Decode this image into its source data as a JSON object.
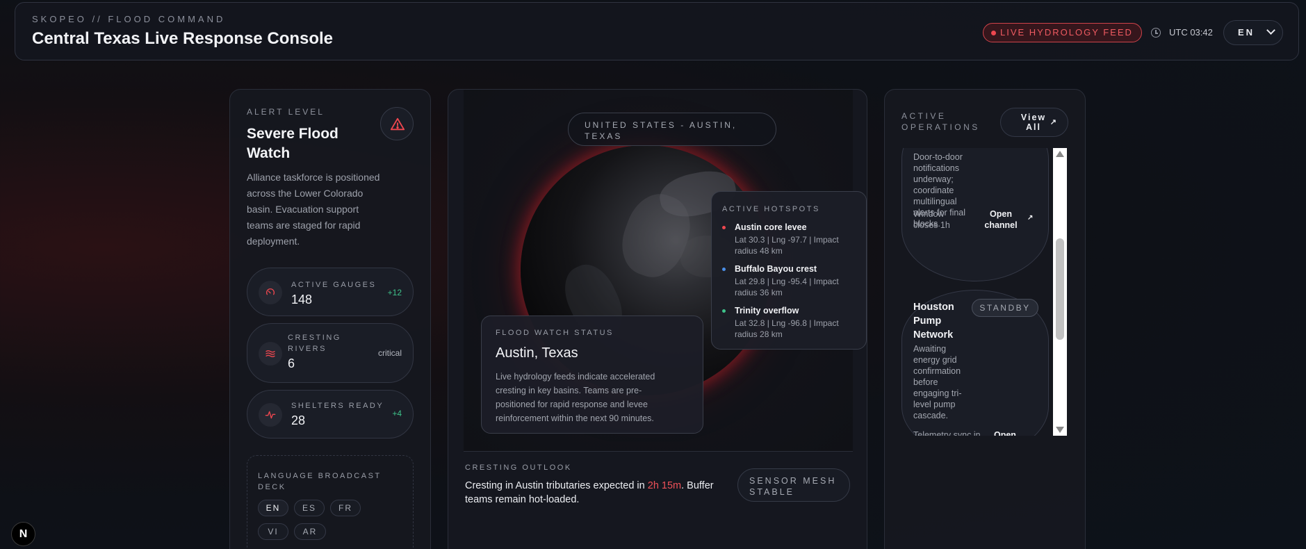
{
  "header": {
    "kicker": "SKOPEO // FLOOD COMMAND",
    "title": "Central Texas Live Response Console",
    "live_feed": "LIVE HYDROLOGY FEED",
    "utc": "UTC 03:42",
    "language": "EN",
    "colors": {
      "accent_red": "#ef474f"
    }
  },
  "alert": {
    "kicker": "ALERT LEVEL",
    "title": "Severe Flood Watch",
    "icon": "warning-triangle-icon",
    "description": "Alliance taskforce is positioned across the Lower Colorado basin. Evacuation support teams are staged for rapid deployment."
  },
  "stats": [
    {
      "label": "ACTIVE GAUGES",
      "value": "148",
      "delta": "+12",
      "icon": "gauge-icon",
      "delta_color": "#3ec28a"
    },
    {
      "label": "CRESTING RIVERS",
      "value": "6",
      "delta": "critical",
      "icon": "waves-icon",
      "delta_color": "#a6aab3"
    },
    {
      "label": "SHELTERS READY",
      "value": "28",
      "delta": "+4",
      "icon": "pulse-icon",
      "delta_color": "#3ec28a"
    }
  ],
  "broadcast": {
    "kicker": "LANGUAGE BROADCAST DECK",
    "languages": [
      "EN",
      "ES",
      "FR",
      "VI",
      "AR"
    ],
    "active": "EN"
  },
  "map": {
    "location": "UNITED STATES - AUSTIN, TEXAS",
    "status_kicker": "FLOOD WATCH STATUS",
    "status_city": "Austin, Texas",
    "status_desc": "Live hydrology feeds indicate accelerated cresting in key basins. Teams are pre-positioned for rapid response and levee reinforcement within the next 90 minutes.",
    "hotspots_kicker": "ACTIVE HOTSPOTS",
    "hotspots": [
      {
        "name": "Austin core levee",
        "meta": "Lat 30.3 | Lng -97.7 | Impact radius 48 km",
        "color": "#ef474f"
      },
      {
        "name": "Buffalo Bayou crest",
        "meta": "Lat 29.8 | Lng -95.4 | Impact radius 36 km",
        "color": "#4a8fe8"
      },
      {
        "name": "Trinity overflow",
        "meta": "Lat 32.8 | Lng -96.8 | Impact radius 28 km",
        "color": "#3ec28a"
      }
    ]
  },
  "outlook": {
    "kicker": "CRESTING OUTLOOK",
    "text_before": "Cresting in Austin tributaries expected in ",
    "highlight": "2h 15m",
    "text_after": ". Buffer teams remain hot-loaded.",
    "sensor": "SENSOR MESH STABLE"
  },
  "operations": {
    "kicker": "ACTIVE OPERATIONS",
    "view_all": "View All",
    "items": [
      {
        "description": "Door-to-door notifications underway; coordinate multilingual alerts for final blocks.",
        "footer": "Window closes 1h",
        "link": "Open channel"
      },
      {
        "title": "Houston Pump Network",
        "badge": "STANDBY",
        "description": "Awaiting energy grid confirmation before engaging tri-level pump cascade.",
        "footer": "Telemetry sync in",
        "link": "Open"
      }
    ]
  },
  "badge": "N"
}
